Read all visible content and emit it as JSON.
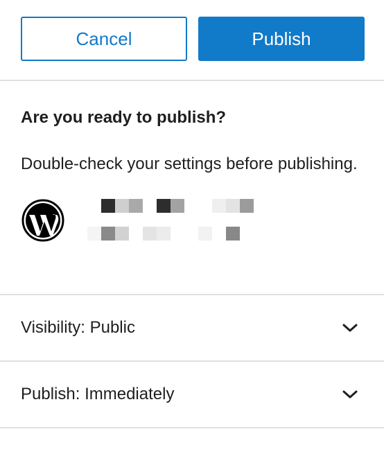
{
  "header": {
    "cancel_label": "Cancel",
    "publish_label": "Publish"
  },
  "prepublish": {
    "title": "Are you ready to publish?",
    "description": "Double-check your settings before publishing.",
    "site_icon": "wordpress-logo-icon"
  },
  "sections": [
    {
      "key": "Visibility:",
      "value": "Public"
    },
    {
      "key": "Publish:",
      "value": "Immediately"
    }
  ],
  "colors": {
    "accent": "#117ac9",
    "divider": "#e0e0e0",
    "text": "#1e1e1e"
  }
}
